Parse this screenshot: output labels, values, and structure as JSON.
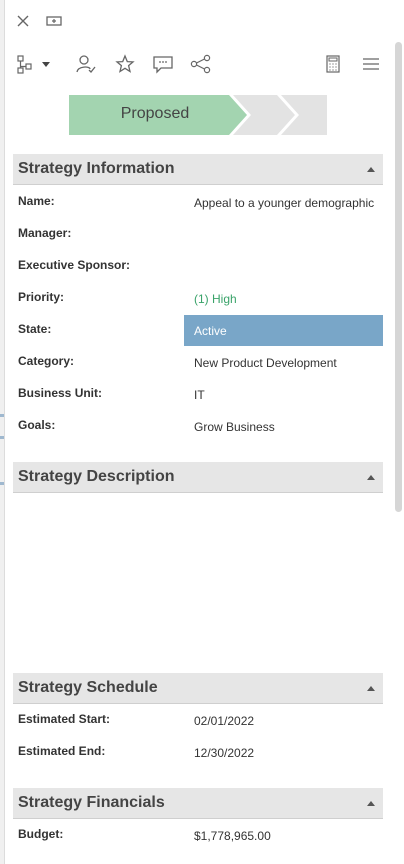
{
  "process": {
    "active_stage": "Proposed"
  },
  "sections": {
    "info": {
      "title": "Strategy Information",
      "fields": {
        "name": {
          "label": "Name:",
          "value": "Appeal to a younger demographic"
        },
        "manager": {
          "label": "Manager:",
          "value": ""
        },
        "sponsor": {
          "label": "Executive Sponsor:",
          "value": ""
        },
        "priority": {
          "label": "Priority:",
          "value": "(1) High"
        },
        "state": {
          "label": "State:",
          "value": "Active"
        },
        "category": {
          "label": "Category:",
          "value": "New Product Development"
        },
        "business_unit": {
          "label": "Business Unit:",
          "value": "IT"
        },
        "goals": {
          "label": "Goals:",
          "value": "Grow Business"
        }
      }
    },
    "description": {
      "title": "Strategy Description"
    },
    "schedule": {
      "title": "Strategy Schedule",
      "fields": {
        "start": {
          "label": "Estimated Start:",
          "value": "02/01/2022"
        },
        "end": {
          "label": "Estimated End:",
          "value": "12/30/2022"
        }
      }
    },
    "financials": {
      "title": "Strategy Financials",
      "fields": {
        "budget": {
          "label": "Budget:",
          "value": "$1,778,965.00"
        }
      }
    }
  },
  "colors": {
    "stage_active": "#a3d4b0",
    "stage_inactive": "#e3e3e3",
    "selected_row": "#79a6c8",
    "priority_high": "#3aa36a"
  }
}
